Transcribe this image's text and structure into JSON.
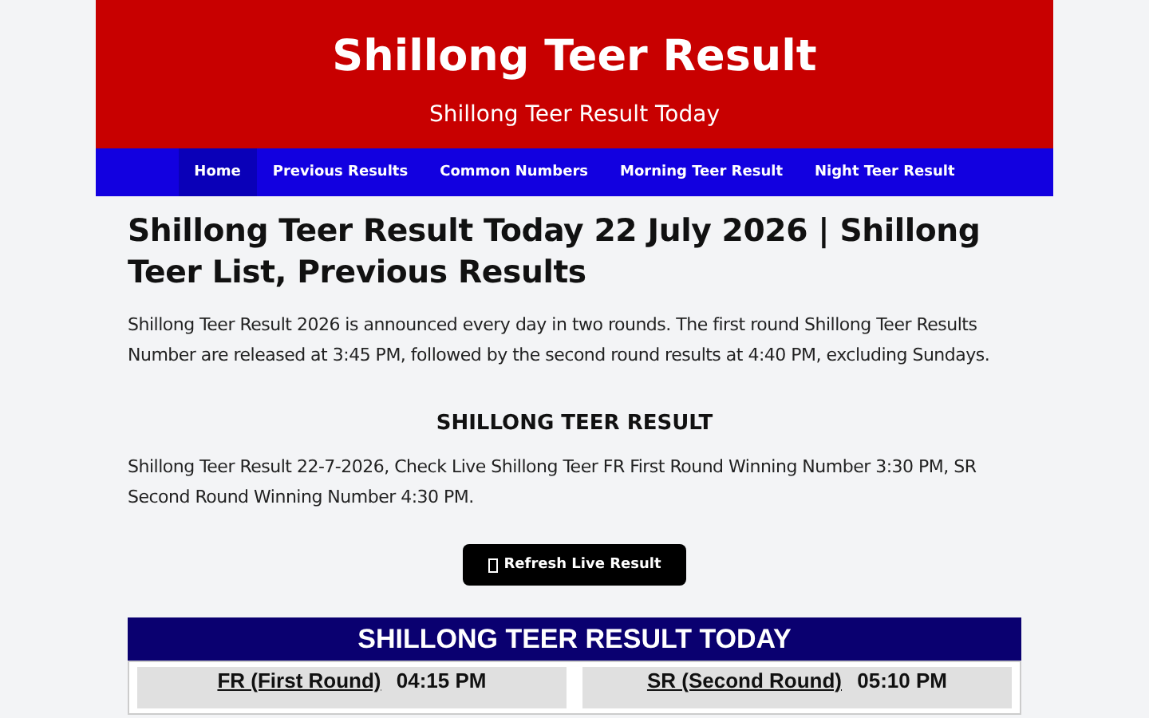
{
  "header": {
    "title": "Shillong Teer Result",
    "subtitle": "Shillong Teer Result Today"
  },
  "nav": [
    {
      "label": "Home",
      "selected": true
    },
    {
      "label": "Previous Results",
      "selected": false
    },
    {
      "label": "Common Numbers",
      "selected": false
    },
    {
      "label": "Morning Teer Result",
      "selected": false
    },
    {
      "label": "Night Teer Result",
      "selected": false
    }
  ],
  "article": {
    "title": "Shillong Teer Result Today 22 July 2026 | Shillong Teer List, Previous Results",
    "intro": "Shillong Teer Result 2026 is announced every day in two rounds. The first round Shillong Teer Results Number are released at 3:45 PM, followed by the second round results at 4:40 PM, excluding Sundays.",
    "section_title": "SHILLONG TEER RESULT",
    "section_text": "Shillong Teer Result 22-7-2026, Check Live Shillong Teer FR First Round Winning Number 3:30 PM, SR Second Round Winning Number 4:30 PM.",
    "refresh_button": "Refresh Live Result"
  },
  "result_table": {
    "title": "SHILLONG TEER RESULT TODAY",
    "rounds": [
      {
        "name": "FR (First Round)",
        "time": "04:15 PM"
      },
      {
        "name": "SR (Second Round)",
        "time": "05:10 PM"
      }
    ]
  }
}
